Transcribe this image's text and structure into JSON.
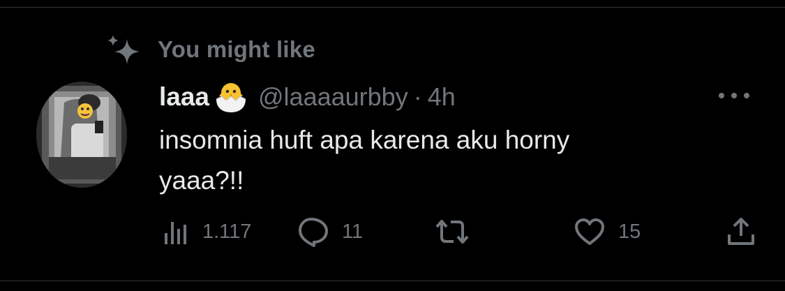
{
  "context_label": "You might like",
  "tweet": {
    "display_name": "laaa",
    "handle": "@laaaaurbby",
    "separator": "·",
    "time": "4h",
    "text_line1": "insomnia huft apa karena aku horny",
    "text_line2": "yaaa?!!"
  },
  "metrics": {
    "views": "1.117",
    "replies": "11",
    "retweets": "",
    "likes": "15"
  },
  "icons": [
    "sparkle-icon",
    "hatching-chick-emoji",
    "more-icon",
    "views-icon",
    "reply-icon",
    "retweet-icon",
    "like-icon",
    "share-icon"
  ],
  "colors": {
    "background": "#000000",
    "text": "#e7e9ea",
    "muted": "#71767b",
    "divider": "#2f3336"
  }
}
